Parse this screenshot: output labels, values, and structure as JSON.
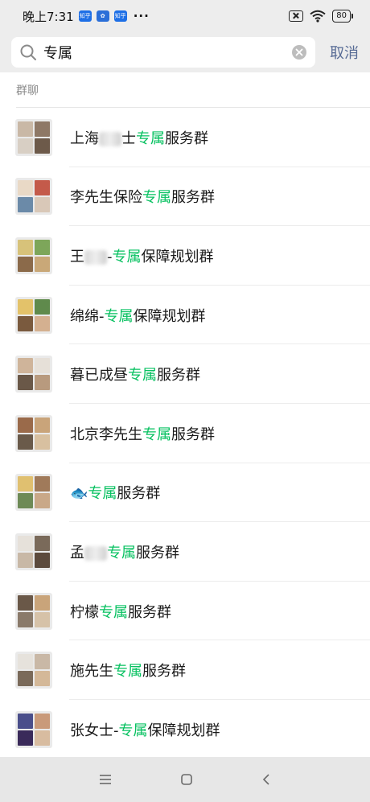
{
  "status_bar": {
    "time": "晚上7:31",
    "badge_1": "知乎",
    "badge_2": "知乎",
    "dots": "···",
    "battery": "80"
  },
  "search": {
    "query": "专属",
    "cancel": "取消"
  },
  "section": {
    "title": "群聊"
  },
  "groups": [
    {
      "before": "上海",
      "masked": true,
      "after": "士",
      "highlight": "专属",
      "tail": "服务群"
    },
    {
      "before": "李先生保险",
      "highlight": "专属",
      "tail": "服务群"
    },
    {
      "before": "王",
      "masked": true,
      "after": "-",
      "highlight": "专属",
      "tail": "保障规划群"
    },
    {
      "before": "绵绵-",
      "highlight": "专属",
      "tail": "保障规划群"
    },
    {
      "before": "暮已成昼",
      "highlight": "专属",
      "tail": "服务群"
    },
    {
      "before": "北京李先生",
      "highlight": "专属",
      "tail": "服务群"
    },
    {
      "before": "",
      "fish": "🐟",
      "highlight": "专属",
      "tail": "服务群"
    },
    {
      "before": "孟",
      "masked": true,
      "after": "",
      "highlight": "专属",
      "tail": "服务群"
    },
    {
      "before": "柠檬",
      "highlight": "专属",
      "tail": "服务群"
    },
    {
      "before": "施先生",
      "highlight": "专属",
      "tail": "服务群"
    },
    {
      "before": "张女士-",
      "highlight": "专属",
      "tail": "保障规划群"
    }
  ],
  "colors": {
    "highlight": "#07c160",
    "cancel": "#576b95",
    "background": "#ededed"
  },
  "icons": [
    "search-icon",
    "clear-icon",
    "menu-icon",
    "home-icon",
    "back-icon"
  ]
}
